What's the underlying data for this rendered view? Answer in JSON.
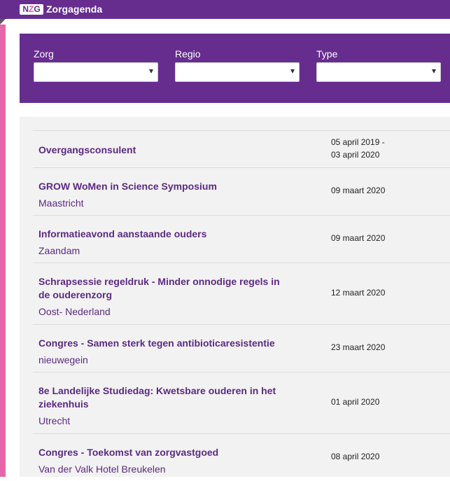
{
  "header": {
    "logo": {
      "n": "N",
      "z": "Z",
      "g": "G"
    },
    "title": "Zorgagenda"
  },
  "filters": [
    {
      "label": "Zorg",
      "value": ""
    },
    {
      "label": "Regio",
      "value": ""
    },
    {
      "label": "Type",
      "value": ""
    }
  ],
  "events": [
    {
      "title": "Overgangsconsulent",
      "location": "",
      "date": "05 april 2019 -\n03 april 2020"
    },
    {
      "title": "GROW WoMen in Science Symposium",
      "location": "Maastricht",
      "date": "09 maart 2020"
    },
    {
      "title": "Informatieavond aanstaande ouders",
      "location": "Zaandam",
      "date": "09 maart 2020"
    },
    {
      "title": "Schrapsessie regeldruk - Minder onnodige regels in de ouderenzorg",
      "location": "Oost- Nederland",
      "date": "12 maart 2020"
    },
    {
      "title": "Congres - Samen sterk tegen antibioticaresistentie",
      "location": "nieuwegein",
      "date": "23 maart 2020"
    },
    {
      "title": "8e Landelijke Studiedag: Kwetsbare ouderen in het ziekenhuis",
      "location": "Utrecht",
      "date": "01 april 2020"
    },
    {
      "title": "Congres - Toekomst van zorgvastgoed",
      "location": "Van der Valk Hotel Breukelen",
      "date": "08 april 2020"
    }
  ],
  "colors": {
    "brand_purple": "#662d8f",
    "accent_pink": "#e467a9",
    "link_purple": "#5c2a82",
    "panel_bg": "#f2f2f2"
  }
}
